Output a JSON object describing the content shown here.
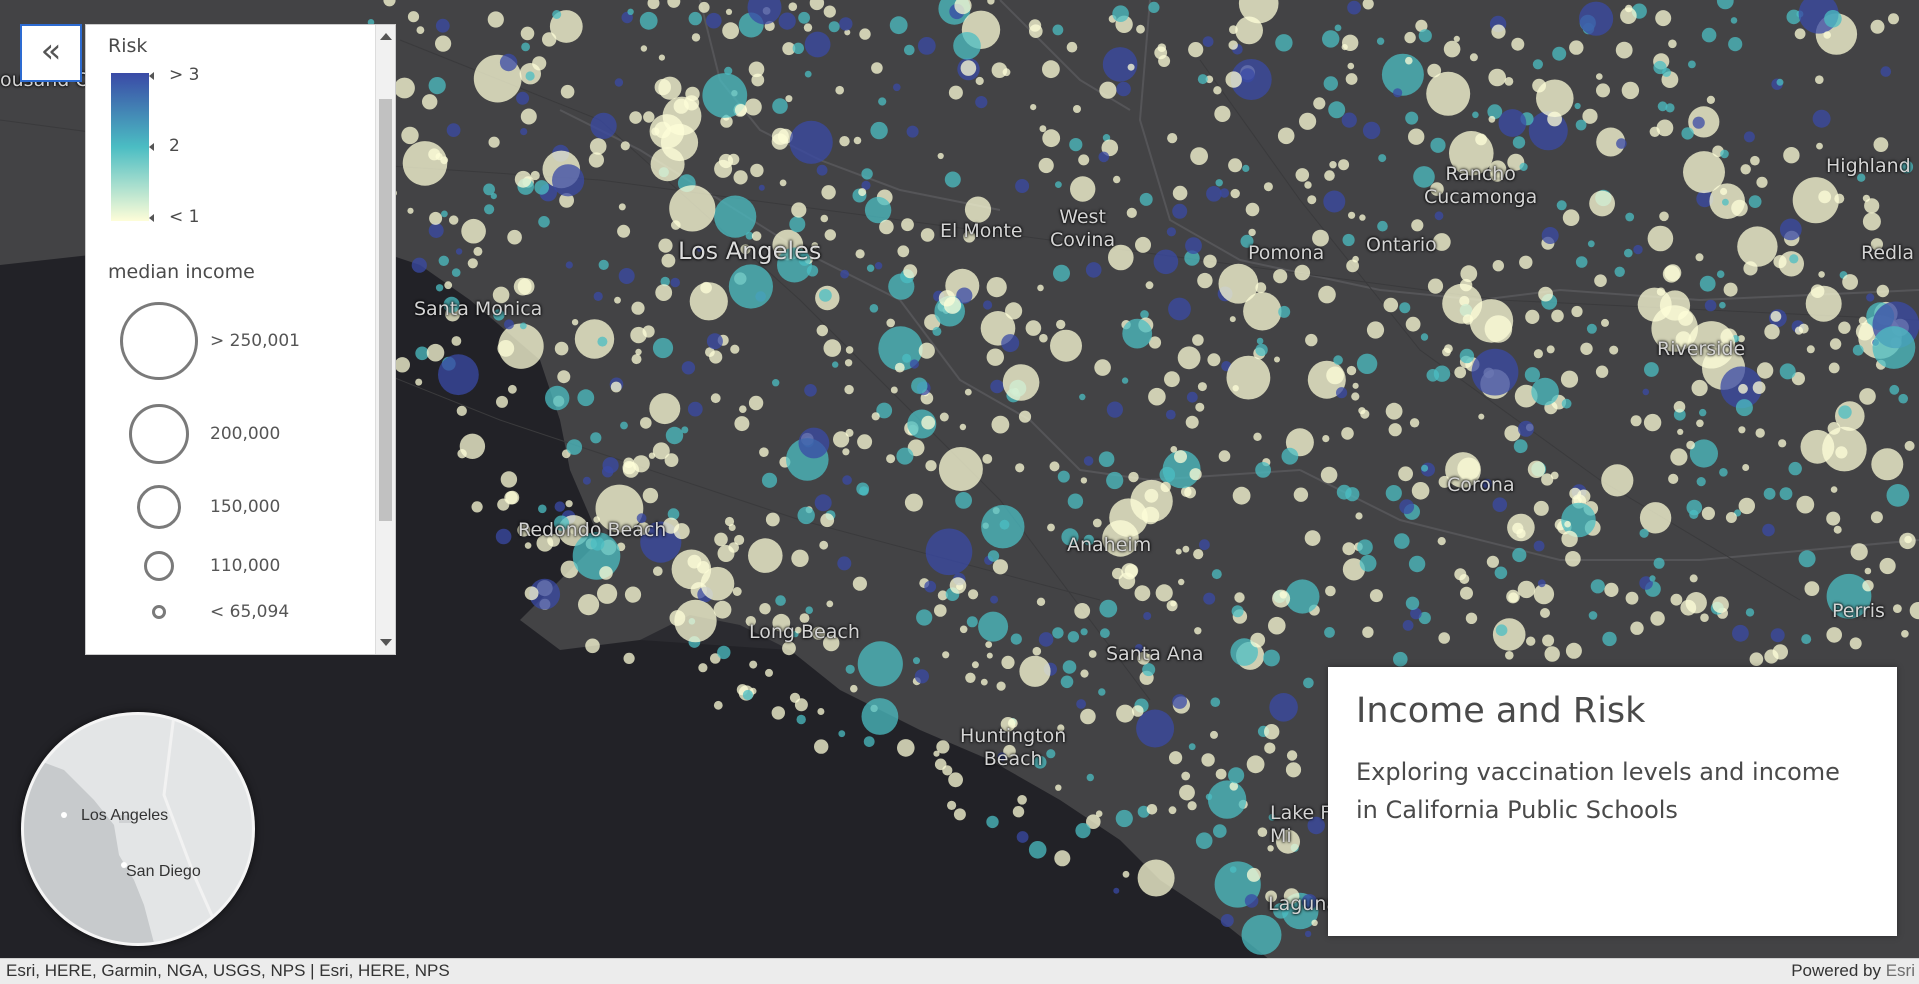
{
  "map": {
    "places": [
      {
        "name": "Thousand Oaks",
        "text": "ousand O"
      },
      {
        "name": "Santa Monica",
        "text": "Santa Monica"
      },
      {
        "name": "Los Angeles",
        "text": "Los Angeles"
      },
      {
        "name": "El Monte",
        "text": "El Monte"
      },
      {
        "name": "West Covina",
        "text": "West\nCovina"
      },
      {
        "name": "Pomona",
        "text": "Pomona"
      },
      {
        "name": "Ontario",
        "text": "Ontario"
      },
      {
        "name": "Rancho Cucamonga",
        "text": "Rancho\nCucamonga"
      },
      {
        "name": "Highland",
        "text": "Highland"
      },
      {
        "name": "Redlands",
        "text": "Redla"
      },
      {
        "name": "Riverside",
        "text": "Riverside"
      },
      {
        "name": "Corona",
        "text": "Corona"
      },
      {
        "name": "Redondo Beach",
        "text": "Redondo Beach"
      },
      {
        "name": "Anaheim",
        "text": "Anaheim"
      },
      {
        "name": "Long Beach",
        "text": "Long Beach"
      },
      {
        "name": "Santa Ana",
        "text": "Santa Ana"
      },
      {
        "name": "Huntington Beach",
        "text": "Huntington\nBeach"
      },
      {
        "name": "Lake Forest",
        "text": "Lake F\nMi"
      },
      {
        "name": "Laguna",
        "text": "Laguna"
      },
      {
        "name": "Perris",
        "text": "Perris"
      }
    ],
    "colors": {
      "low": "#fefdd8",
      "mid": "#4bbdc3",
      "high": "#3a4aa6",
      "land": "#434345",
      "water": "#222227"
    }
  },
  "legend": {
    "risk_title": "Risk",
    "risk_labels": [
      "> 3",
      "2",
      "< 1"
    ],
    "income_title": "median income",
    "income_labels": [
      "> 250,001",
      "200,000",
      "150,000",
      "110,000",
      "< 65,094"
    ]
  },
  "collapse_button": {
    "icon": "double-chevron-left-icon",
    "glyph": "«"
  },
  "overview": {
    "labels": [
      "Los Angeles",
      "San Diego"
    ]
  },
  "info": {
    "title": "Income and Risk",
    "description": "Exploring vaccination levels and income in California Public Schools"
  },
  "attribution": {
    "left": "Esri, HERE, Garmin, NGA, USGS, NPS | Esri, HERE, NPS",
    "powered": "Powered by ",
    "esri": "Esri"
  }
}
